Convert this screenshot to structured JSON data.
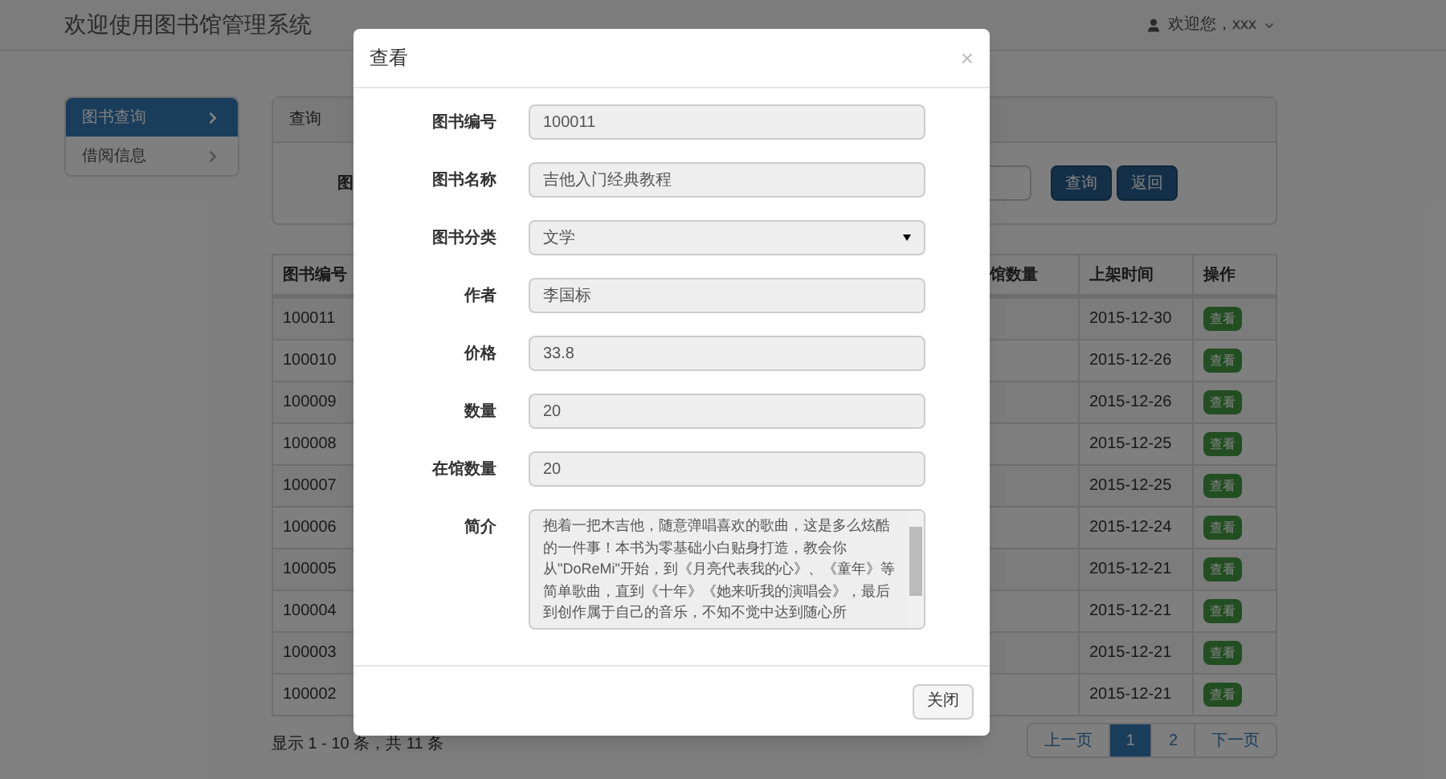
{
  "navbar": {
    "title": "欢迎使用图书馆管理系统",
    "user": "欢迎您，xxx"
  },
  "sidebar": {
    "items": [
      {
        "label": "图书查询",
        "selected": true
      },
      {
        "label": "借阅信息",
        "selected": false
      }
    ]
  },
  "query_panel": {
    "title": "查询",
    "label": "图",
    "buttons": [
      "查询",
      "返回"
    ]
  },
  "table": {
    "columns": [
      "图书编号",
      "馆数量",
      "上架时间",
      "操作"
    ],
    "rows": [
      {
        "id": "100011",
        "date": "2015-12-30",
        "action": "查看"
      },
      {
        "id": "100010",
        "date": "2015-12-26",
        "action": "查看"
      },
      {
        "id": "100009",
        "date": "2015-12-26",
        "action": "查看"
      },
      {
        "id": "100008",
        "date": "2015-12-25",
        "action": "查看"
      },
      {
        "id": "100007",
        "date": "2015-12-25",
        "action": "查看"
      },
      {
        "id": "100006",
        "date": "2015-12-24",
        "action": "查看"
      },
      {
        "id": "100005",
        "date": "2015-12-21",
        "action": "查看"
      },
      {
        "id": "100004",
        "date": "2015-12-21",
        "action": "查看"
      },
      {
        "id": "100003",
        "date": "2015-12-21",
        "action": "查看"
      },
      {
        "id": "100002",
        "date": "2015-12-21",
        "action": "查看"
      }
    ]
  },
  "footer": {
    "summary": "显示 1 - 10 条，共 11 条"
  },
  "pagination": [
    {
      "label": "上一页",
      "selected": false
    },
    {
      "label": "1",
      "selected": true
    },
    {
      "label": "2",
      "selected": false
    },
    {
      "label": "下一页",
      "selected": false
    }
  ],
  "modal": {
    "title": "查看",
    "close_symbol": "×",
    "fields": [
      {
        "kind": "input",
        "label": "图书编号",
        "value": "100011"
      },
      {
        "kind": "input",
        "label": "图书名称",
        "value": "吉他入门经典教程"
      },
      {
        "kind": "select",
        "label": "图书分类",
        "value": "文学"
      },
      {
        "kind": "input",
        "label": "作者",
        "value": "李国标"
      },
      {
        "kind": "input",
        "label": "价格",
        "value": "33.8"
      },
      {
        "kind": "input",
        "label": "数量",
        "value": "20"
      },
      {
        "kind": "input",
        "label": "在馆数量",
        "value": "20"
      },
      {
        "kind": "textarea",
        "label": "简介",
        "value": "抱着一把木吉他，随意弹唱喜欢的歌曲，这是多么炫酷的一件事！本书为零基础小白贴身打造，教会你从\"DoReMi\"开始，到《月亮代表我的心》、《童年》等简单歌曲，直到《十年》《她来听我的演唱会》，最后到创作属于自己的音乐，不知不觉中达到随心所"
      }
    ],
    "footer_button": "关闭"
  }
}
